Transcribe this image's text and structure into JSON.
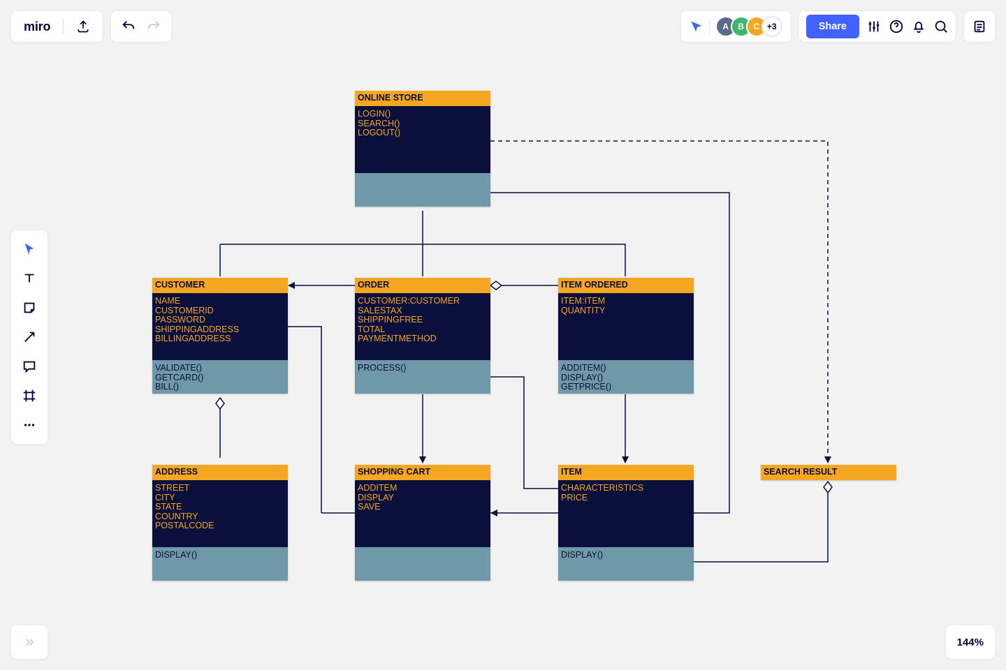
{
  "brand": "miro",
  "collab": {
    "extra": "+3",
    "av1": "A",
    "av2": "B",
    "av3": "C"
  },
  "share_label": "Share",
  "zoom": "144%",
  "uml": {
    "online_store": {
      "title": "ONLINE STORE",
      "body": [
        "LOGIN()",
        "SEARCH()",
        "LOGOUT()"
      ],
      "foot": []
    },
    "customer": {
      "title": "CUSTOMER",
      "body": [
        "NAME",
        "CUSTOMERID",
        "PASSWORD",
        "SHIPPINGADDRESS",
        "BILLINGADDRESS"
      ],
      "foot": [
        "VALIDATE()",
        "GETCARD()",
        "BILL()"
      ]
    },
    "order": {
      "title": "ORDER",
      "body": [
        "CUSTOMER:CUSTOMER",
        "SALESTAX",
        "SHIPPINGFREE",
        "TOTAL",
        "PAYMENTMETHOD"
      ],
      "foot": [
        "PROCESS()"
      ]
    },
    "item_ordered": {
      "title": "ITEM ORDERED",
      "body": [
        "ITEM:ITEM",
        "QUANTITY"
      ],
      "foot": [
        "ADDITEM()",
        "DISPLAY()",
        "GETPRICE()"
      ]
    },
    "address": {
      "title": "ADDRESS",
      "body": [
        "STREET",
        "CITY",
        "STATE",
        "COUNTRY",
        "POSTALCODE"
      ],
      "foot": [
        "DISPLAY()"
      ]
    },
    "shopping_cart": {
      "title": "SHOPPING CART",
      "body": [
        "ADDITEM",
        "DISPLAY",
        "SAVE"
      ],
      "foot": []
    },
    "item": {
      "title": "ITEM",
      "body": [
        "CHARACTERISTICS",
        "PRICE"
      ],
      "foot": [
        "DISPLAY()"
      ]
    },
    "search_result": {
      "title": "SEARCH RESULT",
      "body": [],
      "foot": []
    }
  }
}
